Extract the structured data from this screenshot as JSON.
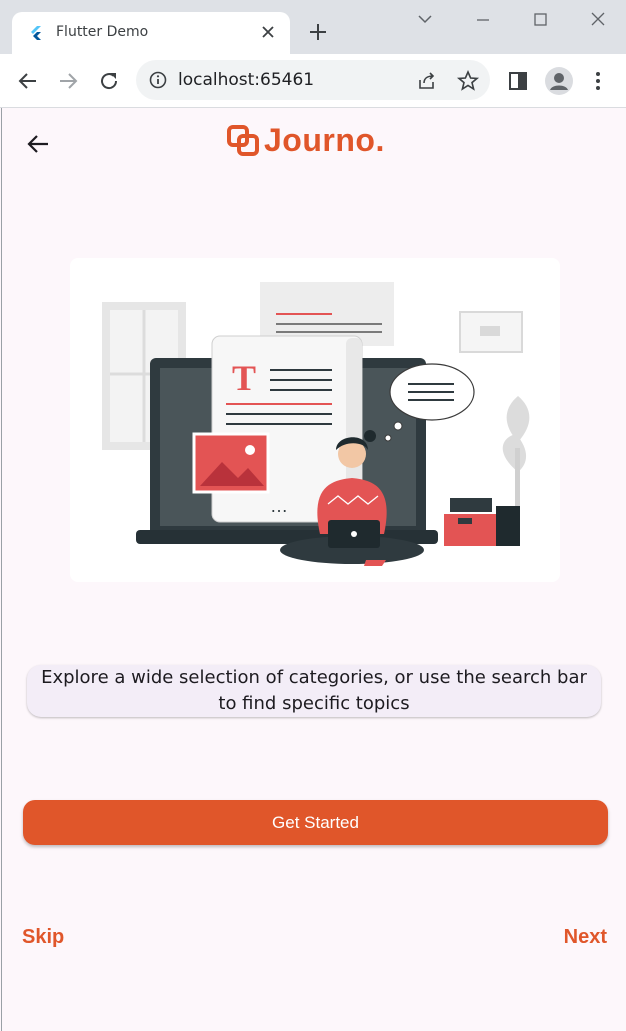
{
  "browser": {
    "tab_title": "Flutter Demo",
    "url": "localhost:65461"
  },
  "app": {
    "logo_text": "Journo.",
    "description": "Explore a wide selection of categories, or use the search bar to find specific topics",
    "cta_label": "Get Started",
    "skip_label": "Skip",
    "next_label": "Next",
    "accent_color": "#e0562a"
  },
  "icons": [
    "flutter-icon",
    "close-icon",
    "plus-icon",
    "minimize-icon",
    "maximize-icon",
    "chevron-down-icon",
    "back-arrow-icon",
    "forward-arrow-icon",
    "reload-icon",
    "info-icon",
    "share-icon",
    "star-icon",
    "sidepanel-icon",
    "profile-icon",
    "kebab-menu-icon"
  ]
}
